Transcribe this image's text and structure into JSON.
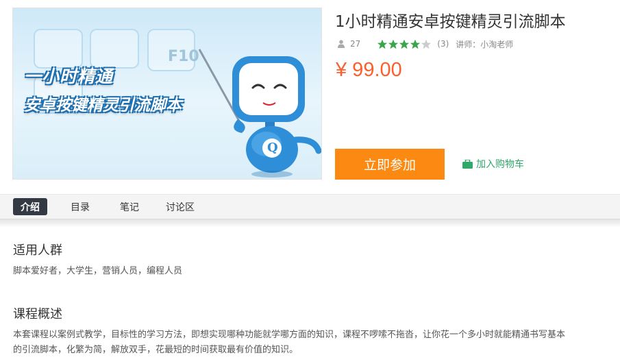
{
  "course": {
    "cover": {
      "key_label": "F10",
      "line1": "一小时精通",
      "line2": "安卓按键精灵引流脚本",
      "mascot_letter": "Q"
    },
    "title": "1小时精通安卓按键精灵引流脚本",
    "students": "27",
    "rating_stars": 4,
    "rating_count": "(3)",
    "teacher": "讲师：小淘老师",
    "price": "¥ 99.00",
    "join_label": "立即参加",
    "cart_label": "加入购物车"
  },
  "tabs": [
    {
      "label": "介绍",
      "active": true
    },
    {
      "label": "目录",
      "active": false
    },
    {
      "label": "笔记",
      "active": false
    },
    {
      "label": "讨论区",
      "active": false
    }
  ],
  "sections": {
    "audience_title": "适用人群",
    "audience_text": "脚本爱好者，大学生，营销人员，编程人员",
    "overview_title": "课程概述",
    "overview_line1": "本套课程以案例式教学，目标性的学习方法，即想实现哪种功能就学哪方面的知识，课程不啰嗦不拖沓，让你花一个多小时就能精通书写基本",
    "overview_line2": "的引流脚本，化繁为简，解放双手，花最短的时间获取最有价值的知识。"
  },
  "colors": {
    "price": "#ff5e2b",
    "join_button": "#fc8a12",
    "cart_green": "#2fa86a",
    "star_green": "#3aa54a",
    "active_tab": "#333a44"
  },
  "icons": [
    "user-icon",
    "star-icon",
    "cart-icon",
    "mascot-illustration"
  ]
}
